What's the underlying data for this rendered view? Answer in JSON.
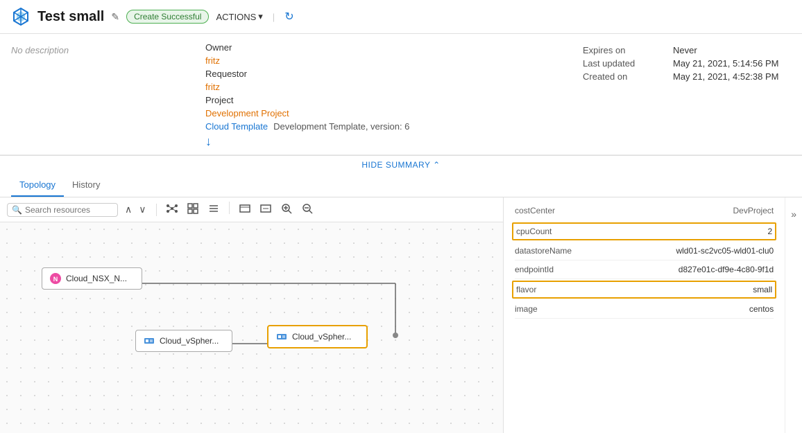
{
  "header": {
    "title": "Test small",
    "status": "Create Successful",
    "actions_label": "ACTIONS",
    "edit_icon": "✎",
    "refresh_icon": "↻",
    "chevron_down": "▾"
  },
  "description": "No description",
  "summary": {
    "owner_label": "Owner",
    "owner_value": "fritz",
    "requestor_label": "Requestor",
    "requestor_value": "fritz",
    "project_label": "Project",
    "project_value": "Development Project",
    "cloud_template_label": "Cloud Template",
    "cloud_template_value": "Development Template, version: 6",
    "expires_label": "Expires on",
    "expires_value": "Never",
    "last_updated_label": "Last updated",
    "last_updated_value": "May 21, 2021, 5:14:56 PM",
    "created_on_label": "Created on",
    "created_on_value": "May 21, 2021, 4:52:38 PM",
    "hide_summary": "HIDE SUMMARY"
  },
  "tabs": [
    {
      "id": "topology",
      "label": "Topology",
      "active": true
    },
    {
      "id": "history",
      "label": "History",
      "active": false
    }
  ],
  "toolbar": {
    "search_placeholder": "Search resources",
    "up_arrow": "∧",
    "down_arrow": "∨"
  },
  "nodes": [
    {
      "id": "nsx",
      "label": "Cloud_NSX_N...",
      "type": "nsx"
    },
    {
      "id": "vsphere1",
      "label": "Cloud_vSpher...",
      "type": "vsphere"
    },
    {
      "id": "vsphere2",
      "label": "Cloud_vSpher...",
      "type": "vsphere",
      "selected": true
    }
  ],
  "right_panel": {
    "col1": "costCenter",
    "col2": "DevProject",
    "expand_icon": "»",
    "properties": [
      {
        "key": "cpuCount",
        "value": "2",
        "highlighted": true
      },
      {
        "key": "datastoreName",
        "value": "wld01-sc2vc05-wld01-clu0",
        "highlighted": false
      },
      {
        "key": "endpointId",
        "value": "d827e01c-df9e-4c80-9f1d",
        "highlighted": false
      },
      {
        "key": "flavor",
        "value": "small",
        "highlighted": true
      },
      {
        "key": "image",
        "value": "centos",
        "highlighted": false
      }
    ]
  },
  "colors": {
    "accent_blue": "#1976d2",
    "accent_orange": "#e07000",
    "selected_border": "#e8a000",
    "green_badge_bg": "#e8f5e9",
    "green_badge_border": "#4caf50",
    "green_badge_text": "#2e7d32"
  }
}
